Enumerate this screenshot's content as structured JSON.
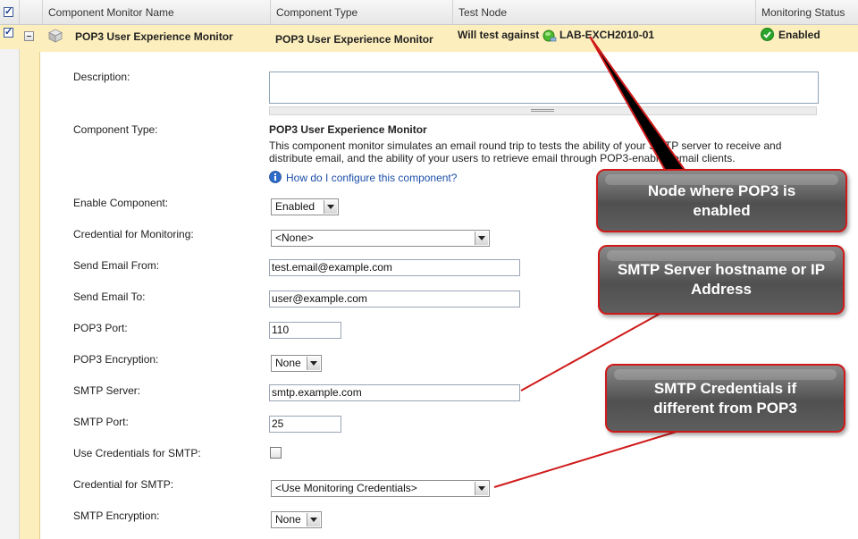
{
  "header": {
    "col_name": "Component Monitor Name",
    "col_type": "Component Type",
    "col_test_node": "Test Node",
    "col_status": "Monitoring Status"
  },
  "row": {
    "name": "POP3 User Experience Monitor",
    "type": "POP3 User Experience Monitor",
    "test_prefix": "Will test against",
    "test_node": "LAB-EXCH2010-01",
    "status": "Enabled"
  },
  "form": {
    "description_label": "Description:",
    "description_value": "",
    "component_type_label": "Component Type:",
    "component_type_value": "POP3 User Experience Monitor",
    "component_desc_line1": "This component monitor simulates an email round trip to tests the ability of your SMTP server to receive and",
    "component_desc_line2": "distribute email, and the ability of your users to retrieve email through POP3-enabled email clients.",
    "help_link": "How do I configure this component?",
    "enable_label": "Enable Component:",
    "enable_value": "Enabled",
    "cred_monitor_label": "Credential for Monitoring:",
    "cred_monitor_value": "<None>",
    "send_from_label": "Send Email From:",
    "send_from_value": "test.email@example.com",
    "send_to_label": "Send Email To:",
    "send_to_value": "user@example.com",
    "pop3_port_label": "POP3 Port:",
    "pop3_port_value": "110",
    "pop3_enc_label": "POP3 Encryption:",
    "pop3_enc_value": "None",
    "smtp_server_label": "SMTP Server:",
    "smtp_server_value": "smtp.example.com",
    "smtp_port_label": "SMTP Port:",
    "smtp_port_value": "25",
    "use_cred_label": "Use Credentials for SMTP:",
    "use_cred_checked": false,
    "cred_smtp_label": "Credential for SMTP:",
    "cred_smtp_value": "<Use Monitoring Credentials>",
    "smtp_enc_label": "SMTP Encryption:",
    "smtp_enc_value": "None"
  },
  "callouts": {
    "node": "Node where POP3 is enabled",
    "smtp_server": "SMTP Server hostname or IP Address",
    "smtp_cred": "SMTP Credentials if different from POP3"
  },
  "colors": {
    "selected_row": "#fdeebd",
    "callout_border": "#d01a1a",
    "callout_fill": "#5a5a5a",
    "link": "#1d4fa8",
    "status_ok": "#2aa52a"
  }
}
